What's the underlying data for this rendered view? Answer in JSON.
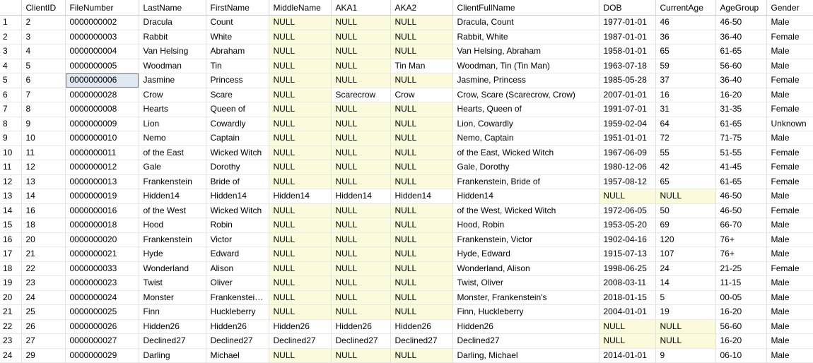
{
  "grid": {
    "columns": [
      {
        "key": "rownum",
        "label": "",
        "cls": "c-rownum"
      },
      {
        "key": "ClientID",
        "label": "ClientID",
        "cls": "c-clientid"
      },
      {
        "key": "FileNumber",
        "label": "FileNumber",
        "cls": "c-filenum"
      },
      {
        "key": "LastName",
        "label": "LastName",
        "cls": "c-lastname"
      },
      {
        "key": "FirstName",
        "label": "FirstName",
        "cls": "c-firstname"
      },
      {
        "key": "MiddleName",
        "label": "MiddleName",
        "cls": "c-middle"
      },
      {
        "key": "AKA1",
        "label": "AKA1",
        "cls": "c-aka1"
      },
      {
        "key": "AKA2",
        "label": "AKA2",
        "cls": "c-aka2"
      },
      {
        "key": "ClientFullName",
        "label": "ClientFullName",
        "cls": "c-fullname"
      },
      {
        "key": "DOB",
        "label": "DOB",
        "cls": "c-dob"
      },
      {
        "key": "CurrentAge",
        "label": "CurrentAge",
        "cls": "c-age"
      },
      {
        "key": "AgeGroup",
        "label": "AgeGroup",
        "cls": "c-agegroup"
      },
      {
        "key": "Gender",
        "label": "Gender",
        "cls": "c-gender"
      }
    ],
    "null_token": "NULL",
    "selected_cell": {
      "row": 5,
      "column": "FileNumber"
    },
    "colors": {
      "null_background": "#fbfbdc",
      "selected_background": "#dfe8f0",
      "selected_border": "#7d7d7d",
      "grid_line": "#e2e2e2",
      "header_rule": "#c6c6c6",
      "text": "#000000",
      "surface": "#ffffff"
    },
    "rows": [
      {
        "rownum": "1",
        "ClientID": "2",
        "FileNumber": "0000000002",
        "LastName": "Dracula",
        "FirstName": "Count",
        "MiddleName": "NULL",
        "AKA1": "NULL",
        "AKA2": "NULL",
        "ClientFullName": "Dracula, Count",
        "DOB": "1977-01-01",
        "CurrentAge": "46",
        "AgeGroup": "46-50",
        "Gender": "Male"
      },
      {
        "rownum": "2",
        "ClientID": "3",
        "FileNumber": "0000000003",
        "LastName": "Rabbit",
        "FirstName": "White",
        "MiddleName": "NULL",
        "AKA1": "NULL",
        "AKA2": "NULL",
        "ClientFullName": "Rabbit, White",
        "DOB": "1987-01-01",
        "CurrentAge": "36",
        "AgeGroup": "36-40",
        "Gender": "Female"
      },
      {
        "rownum": "3",
        "ClientID": "4",
        "FileNumber": "0000000004",
        "LastName": "Van Helsing",
        "FirstName": "Abraham",
        "MiddleName": "NULL",
        "AKA1": "NULL",
        "AKA2": "NULL",
        "ClientFullName": "Van Helsing, Abraham",
        "DOB": "1958-01-01",
        "CurrentAge": "65",
        "AgeGroup": "61-65",
        "Gender": "Male"
      },
      {
        "rownum": "4",
        "ClientID": "5",
        "FileNumber": "0000000005",
        "LastName": "Woodman",
        "FirstName": "Tin",
        "MiddleName": "NULL",
        "AKA1": "NULL",
        "AKA2": "Tin Man",
        "ClientFullName": "Woodman, Tin (Tin Man)",
        "DOB": "1963-07-18",
        "CurrentAge": "59",
        "AgeGroup": "56-60",
        "Gender": "Male"
      },
      {
        "rownum": "5",
        "ClientID": "6",
        "FileNumber": "0000000006",
        "LastName": "Jasmine",
        "FirstName": "Princess",
        "MiddleName": "NULL",
        "AKA1": "NULL",
        "AKA2": "NULL",
        "ClientFullName": "Jasmine, Princess",
        "DOB": "1985-05-28",
        "CurrentAge": "37",
        "AgeGroup": "36-40",
        "Gender": "Female"
      },
      {
        "rownum": "6",
        "ClientID": "7",
        "FileNumber": "0000000028",
        "LastName": "Crow",
        "FirstName": "Scare",
        "MiddleName": "NULL",
        "AKA1": "Scarecrow",
        "AKA2": "Crow",
        "ClientFullName": "Crow, Scare (Scarecrow, Crow)",
        "DOB": "2007-01-01",
        "CurrentAge": "16",
        "AgeGroup": "16-20",
        "Gender": "Male"
      },
      {
        "rownum": "7",
        "ClientID": "8",
        "FileNumber": "0000000008",
        "LastName": "Hearts",
        "FirstName": "Queen of",
        "MiddleName": "NULL",
        "AKA1": "NULL",
        "AKA2": "NULL",
        "ClientFullName": "Hearts, Queen of",
        "DOB": "1991-07-01",
        "CurrentAge": "31",
        "AgeGroup": "31-35",
        "Gender": "Female"
      },
      {
        "rownum": "8",
        "ClientID": "9",
        "FileNumber": "0000000009",
        "LastName": "Lion",
        "FirstName": "Cowardly",
        "MiddleName": "NULL",
        "AKA1": "NULL",
        "AKA2": "NULL",
        "ClientFullName": "Lion, Cowardly",
        "DOB": "1959-02-04",
        "CurrentAge": "64",
        "AgeGroup": "61-65",
        "Gender": "Unknown"
      },
      {
        "rownum": "9",
        "ClientID": "10",
        "FileNumber": "0000000010",
        "LastName": "Nemo",
        "FirstName": "Captain",
        "MiddleName": "NULL",
        "AKA1": "NULL",
        "AKA2": "NULL",
        "ClientFullName": "Nemo, Captain",
        "DOB": "1951-01-01",
        "CurrentAge": "72",
        "AgeGroup": "71-75",
        "Gender": "Male"
      },
      {
        "rownum": "10",
        "ClientID": "11",
        "FileNumber": "0000000011",
        "LastName": "of the East",
        "FirstName": "Wicked Witch",
        "MiddleName": "NULL",
        "AKA1": "NULL",
        "AKA2": "NULL",
        "ClientFullName": "of the East, Wicked Witch",
        "DOB": "1967-06-09",
        "CurrentAge": "55",
        "AgeGroup": "51-55",
        "Gender": "Female"
      },
      {
        "rownum": "11",
        "ClientID": "12",
        "FileNumber": "0000000012",
        "LastName": "Gale",
        "FirstName": "Dorothy",
        "MiddleName": "NULL",
        "AKA1": "NULL",
        "AKA2": "NULL",
        "ClientFullName": "Gale, Dorothy",
        "DOB": "1980-12-06",
        "CurrentAge": "42",
        "AgeGroup": "41-45",
        "Gender": "Female"
      },
      {
        "rownum": "12",
        "ClientID": "13",
        "FileNumber": "0000000013",
        "LastName": "Frankenstein",
        "FirstName": "Bride of",
        "MiddleName": "NULL",
        "AKA1": "NULL",
        "AKA2": "NULL",
        "ClientFullName": "Frankenstein, Bride of",
        "DOB": "1957-08-12",
        "CurrentAge": "65",
        "AgeGroup": "61-65",
        "Gender": "Female"
      },
      {
        "rownum": "13",
        "ClientID": "14",
        "FileNumber": "0000000019",
        "LastName": "Hidden14",
        "FirstName": "Hidden14",
        "MiddleName": "Hidden14",
        "AKA1": "Hidden14",
        "AKA2": "Hidden14",
        "ClientFullName": "Hidden14",
        "DOB": "NULL",
        "CurrentAge": "NULL",
        "AgeGroup": "46-50",
        "Gender": "Male"
      },
      {
        "rownum": "14",
        "ClientID": "16",
        "FileNumber": "0000000016",
        "LastName": "of the West",
        "FirstName": "Wicked Witch",
        "MiddleName": "NULL",
        "AKA1": "NULL",
        "AKA2": "NULL",
        "ClientFullName": "of the West, Wicked Witch",
        "DOB": "1972-06-05",
        "CurrentAge": "50",
        "AgeGroup": "46-50",
        "Gender": "Female"
      },
      {
        "rownum": "15",
        "ClientID": "18",
        "FileNumber": "0000000018",
        "LastName": "Hood",
        "FirstName": "Robin",
        "MiddleName": "NULL",
        "AKA1": "NULL",
        "AKA2": "NULL",
        "ClientFullName": "Hood, Robin",
        "DOB": "1953-05-20",
        "CurrentAge": "69",
        "AgeGroup": "66-70",
        "Gender": "Male"
      },
      {
        "rownum": "16",
        "ClientID": "20",
        "FileNumber": "0000000020",
        "LastName": "Frankenstein",
        "FirstName": "Victor",
        "MiddleName": "NULL",
        "AKA1": "NULL",
        "AKA2": "NULL",
        "ClientFullName": "Frankenstein, Victor",
        "DOB": "1902-04-16",
        "CurrentAge": "120",
        "AgeGroup": "76+",
        "Gender": "Male"
      },
      {
        "rownum": "17",
        "ClientID": "21",
        "FileNumber": "0000000021",
        "LastName": "Hyde",
        "FirstName": "Edward",
        "MiddleName": "NULL",
        "AKA1": "NULL",
        "AKA2": "NULL",
        "ClientFullName": "Hyde, Edward",
        "DOB": "1915-07-13",
        "CurrentAge": "107",
        "AgeGroup": "76+",
        "Gender": "Male"
      },
      {
        "rownum": "18",
        "ClientID": "22",
        "FileNumber": "0000000033",
        "LastName": "Wonderland",
        "FirstName": "Alison",
        "MiddleName": "NULL",
        "AKA1": "NULL",
        "AKA2": "NULL",
        "ClientFullName": "Wonderland, Alison",
        "DOB": "1998-06-25",
        "CurrentAge": "24",
        "AgeGroup": "21-25",
        "Gender": "Female"
      },
      {
        "rownum": "19",
        "ClientID": "23",
        "FileNumber": "0000000023",
        "LastName": "Twist",
        "FirstName": "Oliver",
        "MiddleName": "NULL",
        "AKA1": "NULL",
        "AKA2": "NULL",
        "ClientFullName": "Twist, Oliver",
        "DOB": "2008-03-11",
        "CurrentAge": "14",
        "AgeGroup": "11-15",
        "Gender": "Male"
      },
      {
        "rownum": "20",
        "ClientID": "24",
        "FileNumber": "0000000024",
        "LastName": "Monster",
        "FirstName": "Frankenstei…",
        "MiddleName": "NULL",
        "AKA1": "NULL",
        "AKA2": "NULL",
        "ClientFullName": "Monster, Frankenstein's",
        "DOB": "2018-01-15",
        "CurrentAge": "5",
        "AgeGroup": "00-05",
        "Gender": "Male"
      },
      {
        "rownum": "21",
        "ClientID": "25",
        "FileNumber": "0000000025",
        "LastName": "Finn",
        "FirstName": "Huckleberry",
        "MiddleName": "NULL",
        "AKA1": "NULL",
        "AKA2": "NULL",
        "ClientFullName": "Finn, Huckleberry",
        "DOB": "2004-01-01",
        "CurrentAge": "19",
        "AgeGroup": "16-20",
        "Gender": "Male"
      },
      {
        "rownum": "22",
        "ClientID": "26",
        "FileNumber": "0000000026",
        "LastName": "Hidden26",
        "FirstName": "Hidden26",
        "MiddleName": "Hidden26",
        "AKA1": "Hidden26",
        "AKA2": "Hidden26",
        "ClientFullName": "Hidden26",
        "DOB": "NULL",
        "CurrentAge": "NULL",
        "AgeGroup": "56-60",
        "Gender": "Male"
      },
      {
        "rownum": "23",
        "ClientID": "27",
        "FileNumber": "0000000027",
        "LastName": "Declined27",
        "FirstName": "Declined27",
        "MiddleName": "Declined27",
        "AKA1": "Declined27",
        "AKA2": "Declined27",
        "ClientFullName": "Declined27",
        "DOB": "NULL",
        "CurrentAge": "NULL",
        "AgeGroup": "16-20",
        "Gender": "Male"
      },
      {
        "rownum": "24",
        "ClientID": "29",
        "FileNumber": "0000000029",
        "LastName": "Darling",
        "FirstName": "Michael",
        "MiddleName": "NULL",
        "AKA1": "NULL",
        "AKA2": "NULL",
        "ClientFullName": "Darling, Michael",
        "DOB": "2014-01-01",
        "CurrentAge": "9",
        "AgeGroup": "06-10",
        "Gender": "Male"
      }
    ]
  }
}
